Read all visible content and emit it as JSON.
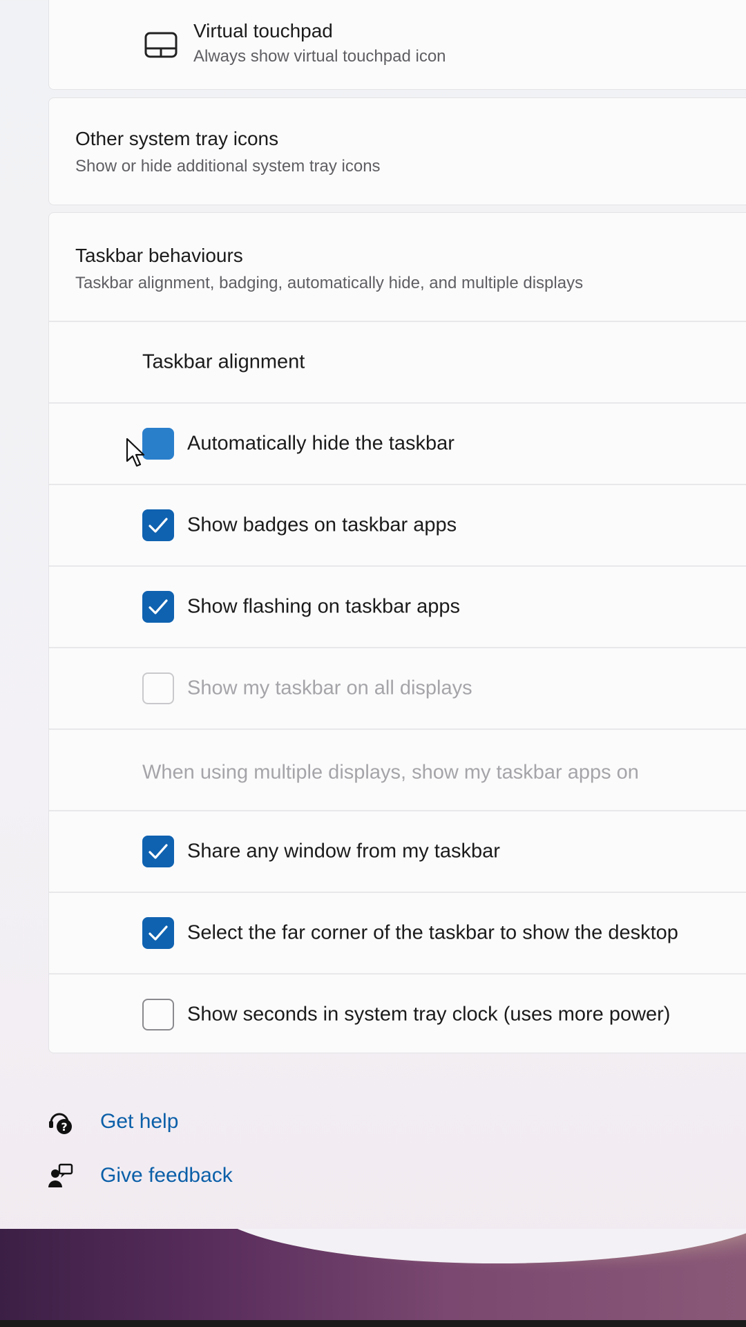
{
  "virtual_touchpad": {
    "title": "Virtual touchpad",
    "subtitle": "Always show virtual touchpad icon",
    "icon": "touchpad-icon"
  },
  "other_tray": {
    "title": "Other system tray icons",
    "subtitle": "Show or hide additional system tray icons"
  },
  "behaviours": {
    "title": "Taskbar behaviours",
    "subtitle": "Taskbar alignment, badging, automatically hide, and multiple displays",
    "alignment_label": "Taskbar alignment",
    "multi_display_label": "When using multiple displays, show my taskbar apps on",
    "options": [
      {
        "label": "Automatically hide the taskbar",
        "checked": false,
        "state": "pressed"
      },
      {
        "label": "Show badges on taskbar apps",
        "checked": true
      },
      {
        "label": "Show flashing on taskbar apps",
        "checked": true
      },
      {
        "label": "Show my taskbar on all displays",
        "checked": false,
        "disabled": true
      },
      {
        "label": "Share any window from my taskbar",
        "checked": true
      },
      {
        "label": "Select the far corner of the taskbar to show the desktop",
        "checked": true
      },
      {
        "label": "Show seconds in system tray clock (uses more power)",
        "checked": false
      }
    ]
  },
  "footer": {
    "get_help": "Get help",
    "give_feedback": "Give feedback"
  },
  "colors": {
    "accent": "#0f62b0",
    "link": "#0b5fa8"
  }
}
